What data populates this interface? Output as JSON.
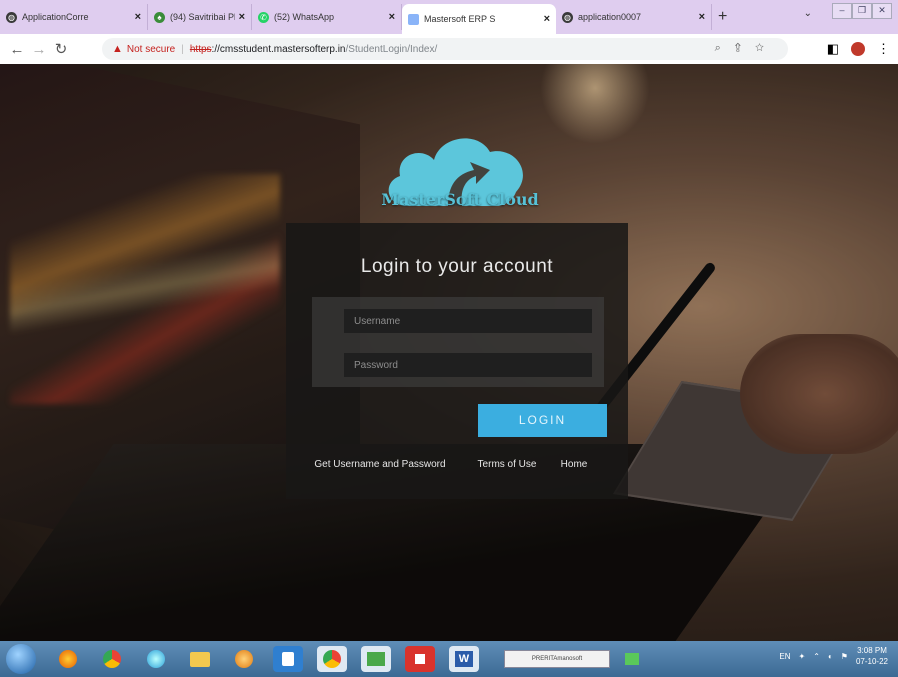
{
  "browser": {
    "tabs": [
      {
        "title": "ApplicationCorre",
        "icon": "globe-icon",
        "color": "#3a3a3a"
      },
      {
        "title": "(94) Savitribai Ph",
        "icon": "app-icon",
        "color": "#3a8c3a"
      },
      {
        "title": "(52) WhatsApp",
        "icon": "whatsapp-icon",
        "color": "#25d366"
      },
      {
        "title": "Mastersoft ERP S",
        "icon": "page-icon",
        "color": "#8ab4f8",
        "active": true
      },
      {
        "title": "application0007",
        "icon": "globe-icon",
        "color": "#3a3a3a"
      }
    ],
    "new_tab": "+",
    "security_label": "Not secure",
    "url_scheme": "https",
    "url_host": "://cmsstudent.mastersofterp.in",
    "url_path": "/StudentLogin/Index/"
  },
  "page": {
    "brand": "MasterSoft Cloud",
    "heading": "Login to your account",
    "username_placeholder": "Username",
    "password_placeholder": "Password",
    "login_label": "LOGIN",
    "link_credentials": "Get Username and Password",
    "link_terms": "Terms of Use",
    "link_home": "Home"
  },
  "colors": {
    "accent": "#3baee0",
    "logo": "#5cc6db",
    "tabstrip": "#dfcdef"
  },
  "taskbar": {
    "preview_text": "PRERITAmanosoft",
    "lang": "EN",
    "time": "3:08 PM",
    "date": "07-10-22"
  }
}
